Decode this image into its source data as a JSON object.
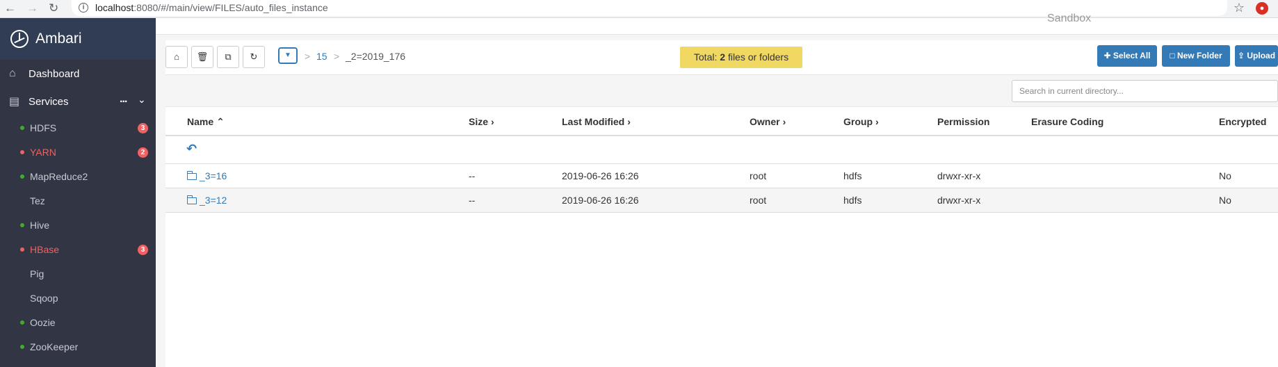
{
  "browser": {
    "url_host": "localhost",
    "url_path": ":8080/#/main/view/FILES/auto_files_instance"
  },
  "sidebar": {
    "brand": "Ambari",
    "dashboard": "Dashboard",
    "services": "Services",
    "more": "...",
    "items": [
      {
        "label": "HDFS",
        "status": "green",
        "badge": "3"
      },
      {
        "label": "YARN",
        "status": "red",
        "badge": "2"
      },
      {
        "label": "MapReduce2",
        "status": "green",
        "badge": ""
      },
      {
        "label": "Tez",
        "status": "none",
        "badge": ""
      },
      {
        "label": "Hive",
        "status": "green",
        "badge": ""
      },
      {
        "label": "HBase",
        "status": "red",
        "badge": "3"
      },
      {
        "label": "Pig",
        "status": "none",
        "badge": ""
      },
      {
        "label": "Sqoop",
        "status": "none",
        "badge": ""
      },
      {
        "label": "Oozie",
        "status": "green",
        "badge": ""
      },
      {
        "label": "ZooKeeper",
        "status": "green",
        "badge": ""
      }
    ]
  },
  "header": {
    "sandbox": "Sandbox"
  },
  "toolbar": {
    "breadcrumb_sep": ">",
    "breadcrumb_link": "15",
    "breadcrumb_current": "_2=2019_176",
    "total_prefix": "Total:",
    "total_count": "2",
    "total_suffix": "files or folders",
    "select_all": "Select All",
    "new_folder": "New Folder",
    "upload": "Upload"
  },
  "search": {
    "placeholder": "Search in current directory..."
  },
  "table": {
    "columns": {
      "name": "Name",
      "size": "Size",
      "modified": "Last Modified",
      "owner": "Owner",
      "group": "Group",
      "permission": "Permission",
      "erasure": "Erasure Coding",
      "encrypted": "Encrypted"
    },
    "rows": [
      {
        "name": "_3=16",
        "size": "--",
        "modified": "2019-06-26 16:26",
        "owner": "root",
        "group": "hdfs",
        "permission": "drwxr-xr-x",
        "erasure": "",
        "encrypted": "No"
      },
      {
        "name": "_3=12",
        "size": "--",
        "modified": "2019-06-26 16:26",
        "owner": "root",
        "group": "hdfs",
        "permission": "drwxr-xr-x",
        "erasure": "",
        "encrypted": "No"
      }
    ]
  },
  "colors": {
    "sidebar_bg": "#323544",
    "brand_bg": "#313d54",
    "status_green": "#3fae2a",
    "status_red": "#ef6162",
    "primary": "#337ab7",
    "total_bg": "#f0d863"
  }
}
